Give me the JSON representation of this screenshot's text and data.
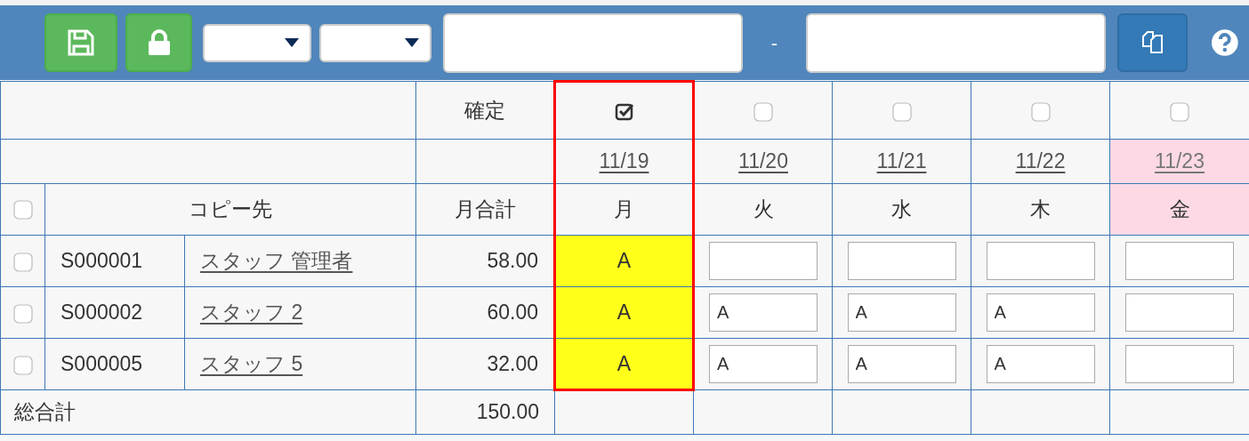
{
  "toolbar": {
    "separator": "-"
  },
  "header": {
    "confirm_label": "確定",
    "copy_to_label": "コピー先",
    "month_total_label": "月合計",
    "select_all_checked": false
  },
  "days": [
    {
      "date": "11/19",
      "weekday": "月",
      "confirmed": true,
      "holiday": false
    },
    {
      "date": "11/20",
      "weekday": "火",
      "confirmed": false,
      "holiday": false
    },
    {
      "date": "11/21",
      "weekday": "水",
      "confirmed": false,
      "holiday": false
    },
    {
      "date": "11/22",
      "weekday": "木",
      "confirmed": false,
      "holiday": false
    },
    {
      "date": "11/23",
      "weekday": "金",
      "confirmed": false,
      "holiday": true
    }
  ],
  "rows": [
    {
      "checked": false,
      "code": "S000001",
      "name": "スタッフ 管理者",
      "total": "58.00",
      "cells": [
        "A",
        null,
        null,
        null,
        null
      ]
    },
    {
      "checked": false,
      "code": "S000002",
      "name": "スタッフ 2",
      "total": "60.00",
      "cells": [
        "A",
        "A",
        "A",
        "A",
        null
      ]
    },
    {
      "checked": false,
      "code": "S000005",
      "name": "スタッフ 5",
      "total": "32.00",
      "cells": [
        "A",
        "A",
        "A",
        "A",
        null
      ]
    }
  ],
  "footer": {
    "label": "総合計",
    "total": "150.00"
  }
}
